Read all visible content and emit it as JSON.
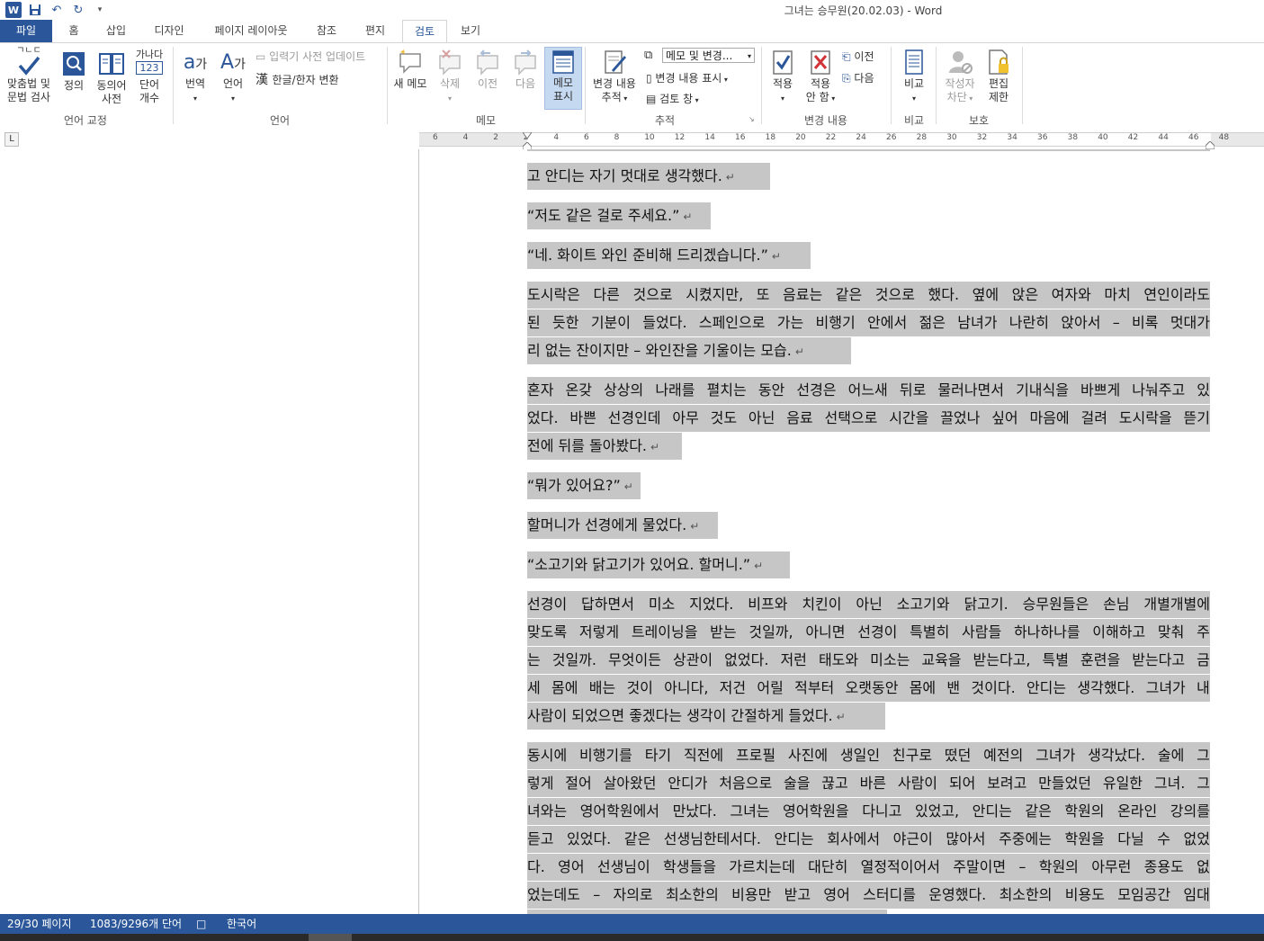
{
  "window": {
    "title": "그녀는 승무원(20.02.03) - Word"
  },
  "qat": {
    "customize": "▾"
  },
  "tabs": [
    "파일",
    "홈",
    "삽입",
    "디자인",
    "페이지 레이아웃",
    "참조",
    "편지",
    "검토",
    "보기"
  ],
  "ribbon": {
    "proofing": {
      "spelling": [
        "맞춤법 및",
        "문법 검사"
      ],
      "define": "정의",
      "thesaurus": [
        "동의어",
        "사전"
      ],
      "wordcount": [
        "단어",
        "개수"
      ],
      "wordcount_icon_text": [
        "가나다",
        "123"
      ],
      "spell_icon_text": "ㄱㄴㄷ",
      "group": "언어 교정"
    },
    "language": {
      "translate": "번역",
      "language": "언어",
      "ime_update": "입력기 사전 업데이트",
      "hanja": "한글/한자 변환",
      "group": "언어"
    },
    "comments": {
      "new": "새 메모",
      "delete": "삭제",
      "prev": "이전",
      "next": "다음",
      "show": [
        "메모",
        "표시"
      ],
      "group": "메모"
    },
    "tracking": {
      "track": [
        "변경 내용",
        "추적"
      ],
      "markup_combo": "메모 및 변경...",
      "show_markup": "변경 내용 표시",
      "review_pane": "검토 창",
      "group": "추적"
    },
    "changes": {
      "accept": "적용",
      "reject": [
        "적용",
        "안 함"
      ],
      "prev": "이전",
      "next": "다음",
      "group": "변경 내용"
    },
    "compare": {
      "compare": "비교",
      "group": "비교"
    },
    "protect": {
      "block_authors": [
        "작성자",
        "차단"
      ],
      "restrict": [
        "편집",
        "제한"
      ],
      "group": "보호"
    }
  },
  "ruler": {
    "tab_selector": "L",
    "ticks": [
      "6",
      "4",
      "2",
      "2",
      "4",
      "6",
      "8",
      "10",
      "12",
      "14",
      "16",
      "18",
      "20",
      "22",
      "24",
      "26",
      "28",
      "30",
      "32",
      "34",
      "36",
      "38",
      "40",
      "42",
      "44",
      "46",
      "48"
    ]
  },
  "document": {
    "paragraphs": [
      {
        "lines": [
          [
            "고",
            "안디는",
            "자기",
            "멋대로",
            "생각했다."
          ]
        ],
        "last": "고 안디는 자기 멋대로 생각했다."
      },
      {
        "last": "“저도 같은 걸로 주세요.”"
      },
      {
        "last": "“네. 화이트 와인 준비해 드리겠습니다.”"
      },
      {
        "lines": [
          "도시락은 다른 것으로 시켰지만, 또 음료는 같은 것으로 했다. 옆에 앉은 여자와 마치 연인이라도",
          "된 듯한 기분이 들었다. 스페인으로 가는 비행기 안에서 젊은 남녀가 나란히 앉아서 – 비록 멋대가"
        ],
        "last": "리 없는 잔이지만 – 와인잔을 기울이는 모습."
      },
      {
        "lines": [
          "혼자 온갖 상상의 나래를 펼치는 동안 선경은 어느새 뒤로 물러나면서 기내식을 바쁘게 나눠주고 있",
          "었다. 바쁜 선경인데 아무 것도 아닌 음료 선택으로 시간을 끌었나 싶어 마음에 걸려 도시락을 뜯기"
        ],
        "last": "전에 뒤를 돌아봤다."
      },
      {
        "last": "“뭐가 있어요?”"
      },
      {
        "last": "할머니가 선경에게 물었다."
      },
      {
        "last": "“소고기와 닭고기가 있어요. 할머니.”"
      },
      {
        "lines": [
          "선경이 답하면서 미소 지었다. 비프와 치킨이 아닌 소고기와 닭고기. 승무원들은 손님 개별개별에",
          "맞도록 저렇게 트레이닝을 받는 것일까, 아니면 선경이 특별히 사람들 하나하나를 이해하고 맞춰 주",
          "는 것일까. 무엇이든 상관이 없었다. 저런 태도와 미소는 교육을 받는다고, 특별 훈련을 받는다고 금",
          "세 몸에 배는 것이 아니다, 저건 어릴 적부터 오랫동안 몸에 밴 것이다. 안디는 생각했다. 그녀가 내"
        ],
        "last": "사람이 되었으면 좋겠다는 생각이 간절하게 들었다."
      },
      {
        "lines": [
          "동시에 비행기를 타기 직전에 프로필 사진에 생일인 친구로 떴던 예전의 그녀가 생각났다. 술에 그",
          "렇게 절어 살아왔던 안디가 처음으로 술을 끊고 바른 사람이 되어 보려고 만들었던 유일한 그녀. 그",
          "녀와는 영어학원에서 만났다. 그녀는 영어학원을 다니고 있었고, 안디는 같은 학원의 온라인 강의를",
          "듣고 있었다. 같은 선생님한테서다. 안디는 회사에서 야근이 많아서 주중에는 학원을 다닐 수 없었",
          "다. 영어 선생님이 학생들을 가르치는데 대단히 열정적이어서 주말이면 – 학원의 아무런 종용도 없",
          "었는데도 – 자의로 최소한의 비용만 받고 영어 스터디를 운영했다. 최소한의 비용도 모임공간 임대"
        ],
        "last": ""
      }
    ],
    "paragraph_mark": "↵"
  },
  "status": {
    "page": "29/30 페이지",
    "words": "1083/9296개 단어",
    "proof_icon": "□",
    "language": "한국어"
  },
  "colors": {
    "accent": "#2b579a",
    "selection": "#c6c6c6"
  }
}
